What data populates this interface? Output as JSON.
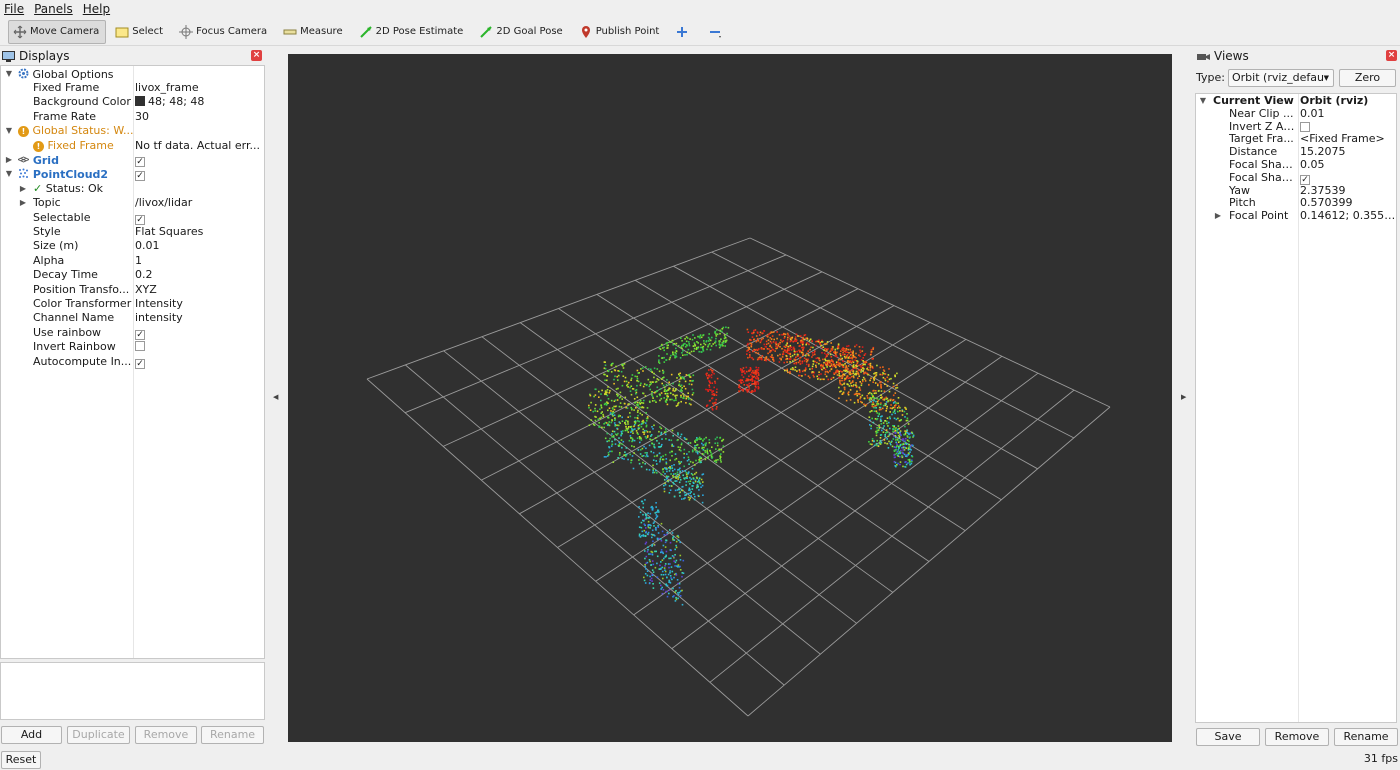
{
  "menu": [
    "File",
    "Panels",
    "Help"
  ],
  "toolbar": {
    "tools": [
      {
        "label": "Move Camera",
        "icon": "move-camera-icon",
        "active": true
      },
      {
        "label": "Select",
        "icon": "select-icon"
      },
      {
        "label": "Focus Camera",
        "icon": "focus-camera-icon"
      },
      {
        "label": "Measure",
        "icon": "measure-icon"
      },
      {
        "label": "2D Pose Estimate",
        "icon": "pose-estimate-icon"
      },
      {
        "label": "2D Goal Pose",
        "icon": "goal-pose-icon"
      },
      {
        "label": "Publish Point",
        "icon": "publish-point-icon"
      }
    ]
  },
  "displays": {
    "title": "Displays",
    "rows": [
      {
        "label": "Global Options",
        "value": ""
      },
      {
        "label": "Fixed Frame",
        "value": "livox_frame"
      },
      {
        "label": "Background Color",
        "value": "48; 48; 48"
      },
      {
        "label": "Frame Rate",
        "value": "30"
      },
      {
        "label": "Global Status: W...",
        "value": ""
      },
      {
        "label": "Fixed Frame",
        "value": "No tf data.  Actual err..."
      },
      {
        "label": "Grid",
        "value": ""
      },
      {
        "label": "PointCloud2",
        "value": ""
      },
      {
        "label": "Status: Ok",
        "value": ""
      },
      {
        "label": "Topic",
        "value": "/livox/lidar"
      },
      {
        "label": "Selectable",
        "value": ""
      },
      {
        "label": "Style",
        "value": "Flat Squares"
      },
      {
        "label": "Size (m)",
        "value": "0.01"
      },
      {
        "label": "Alpha",
        "value": "1"
      },
      {
        "label": "Decay Time",
        "value": "0.2"
      },
      {
        "label": "Position Transfo...",
        "value": "XYZ"
      },
      {
        "label": "Color Transformer",
        "value": "Intensity"
      },
      {
        "label": "Channel Name",
        "value": "intensity"
      },
      {
        "label": "Use rainbow",
        "value": ""
      },
      {
        "label": "Invert Rainbow",
        "value": ""
      },
      {
        "label": "Autocompute In...",
        "value": ""
      }
    ],
    "buttons": {
      "add": "Add",
      "duplicate": "Duplicate",
      "remove": "Remove",
      "rename": "Rename"
    },
    "reset": "Reset"
  },
  "views": {
    "title": "Views",
    "type_label": "Type:",
    "type_value": "Orbit (rviz_defau",
    "zero": "Zero",
    "rows": [
      {
        "label": "Current View",
        "value": "Orbit (rviz)"
      },
      {
        "label": "Near Clip ...",
        "value": "0.01"
      },
      {
        "label": "Invert Z Axis",
        "value": ""
      },
      {
        "label": "Target Fra...",
        "value": "<Fixed Frame>"
      },
      {
        "label": "Distance",
        "value": "15.2075"
      },
      {
        "label": "Focal Shap...",
        "value": "0.05"
      },
      {
        "label": "Focal Shap...",
        "value": ""
      },
      {
        "label": "Yaw",
        "value": "2.37539"
      },
      {
        "label": "Pitch",
        "value": "0.570399"
      },
      {
        "label": "Focal Point",
        "value": "0.14612; 0.3551..."
      }
    ],
    "buttons": {
      "save": "Save",
      "remove": "Remove",
      "rename": "Rename"
    }
  },
  "status": {
    "fps": "31 fps"
  },
  "colors": {
    "background": "#303030",
    "grid": "#a0a0a0",
    "warning": "#e29a16",
    "link_blue": "#2a6fc2"
  }
}
